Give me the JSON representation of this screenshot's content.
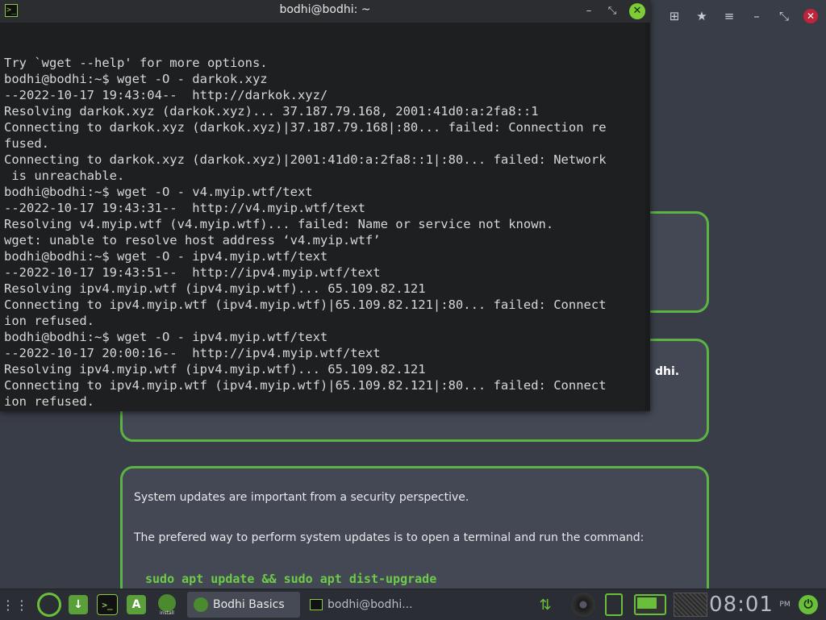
{
  "background": {
    "card2_tail": "dhi.",
    "card3": {
      "line1": "System updates are important from a security perspective.",
      "line2": "The prefered way to perform system updates is to open a terminal and run the command:",
      "command": "sudo apt update && sudo apt dist-upgrade"
    }
  },
  "terminal": {
    "title": "bodhi@bodhi: ~",
    "lines": [
      "",
      "Try `wget --help' for more options.",
      "bodhi@bodhi:~$ wget -O - darkok.xyz",
      "--2022-10-17 19:43:04--  http://darkok.xyz/",
      "Resolving darkok.xyz (darkok.xyz)... 37.187.79.168, 2001:41d0:a:2fa8::1",
      "Connecting to darkok.xyz (darkok.xyz)|37.187.79.168|:80... failed: Connection re",
      "fused.",
      "Connecting to darkok.xyz (darkok.xyz)|2001:41d0:a:2fa8::1|:80... failed: Network",
      " is unreachable.",
      "bodhi@bodhi:~$ wget -O - v4.myip.wtf/text",
      "--2022-10-17 19:43:31--  http://v4.myip.wtf/text",
      "Resolving v4.myip.wtf (v4.myip.wtf)... failed: Name or service not known.",
      "wget: unable to resolve host address ‘v4.myip.wtf’",
      "bodhi@bodhi:~$ wget -O - ipv4.myip.wtf/text",
      "--2022-10-17 19:43:51--  http://ipv4.myip.wtf/text",
      "Resolving ipv4.myip.wtf (ipv4.myip.wtf)... 65.109.82.121",
      "Connecting to ipv4.myip.wtf (ipv4.myip.wtf)|65.109.82.121|:80... failed: Connect",
      "ion refused.",
      "bodhi@bodhi:~$ wget -O - ipv4.myip.wtf/text",
      "--2022-10-17 20:00:16--  http://ipv4.myip.wtf/text",
      "Resolving ipv4.myip.wtf (ipv4.myip.wtf)... 65.109.82.121",
      "Connecting to ipv4.myip.wtf (ipv4.myip.wtf)|65.109.82.121|:80... failed: Connect",
      "ion refused."
    ],
    "prompt": "bodhi@bodhi:~$"
  },
  "taskbar": {
    "tasks": [
      "Bodhi Basics",
      "bodhi@bodhi..."
    ],
    "install_label": "install",
    "clock": "08:01",
    "ampm": "PM"
  },
  "icons": {
    "terminal_glyph": ">_",
    "shutdown_glyph": "⏻",
    "network_glyph": "⇅",
    "apps_glyph": "A",
    "install_glyph": "↓"
  },
  "colors": {
    "accent": "#6abf3a",
    "card_border": "#5ab542",
    "terminal_bg": "#1e1f21",
    "close_red": "#c0243a"
  }
}
